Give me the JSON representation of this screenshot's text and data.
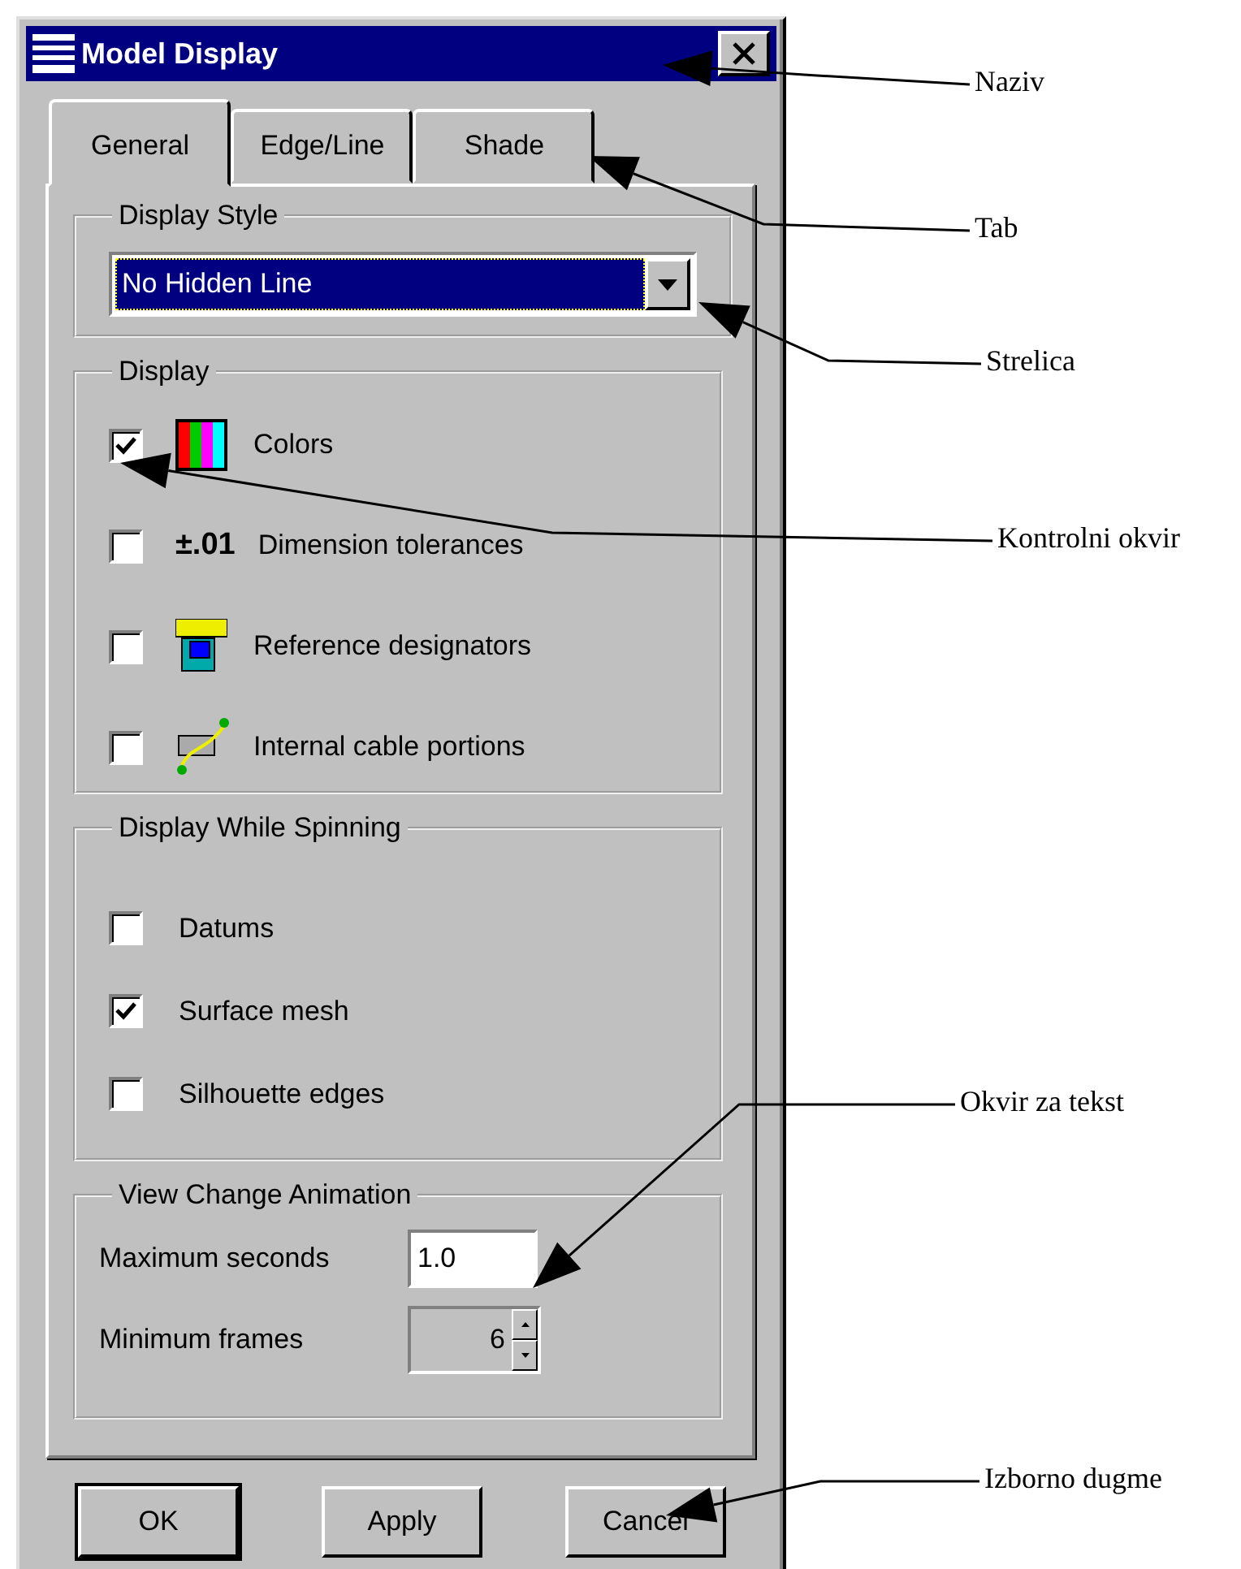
{
  "window": {
    "title": "Model Display"
  },
  "tabs": [
    {
      "label": "General",
      "selected": true
    },
    {
      "label": "Edge/Line",
      "selected": false
    },
    {
      "label": "Shade",
      "selected": false
    }
  ],
  "display_style": {
    "legend": "Display Style",
    "value": "No Hidden Line"
  },
  "display": {
    "legend": "Display",
    "items": [
      {
        "kind": "colors",
        "label": "Colors",
        "checked": true
      },
      {
        "kind": "symbol",
        "symbol": "±.01",
        "label": "Dimension tolerances",
        "checked": false
      },
      {
        "kind": "designator",
        "label": "Reference designators",
        "checked": false
      },
      {
        "kind": "cable",
        "label": "Internal cable portions",
        "checked": false
      }
    ]
  },
  "spinning": {
    "legend": "Display While Spinning",
    "items": [
      {
        "label": "Datums",
        "checked": false
      },
      {
        "label": "Surface mesh",
        "checked": true
      },
      {
        "label": "Silhouette edges",
        "checked": false
      }
    ]
  },
  "animation": {
    "legend": "View Change Animation",
    "fields": [
      {
        "kind": "text",
        "label": "Maximum seconds",
        "value": "1.0",
        "disabled": false
      },
      {
        "kind": "spin",
        "label": "Minimum frames",
        "value": "6",
        "disabled": true
      }
    ]
  },
  "buttons": [
    {
      "label": "OK",
      "default": true
    },
    {
      "label": "Apply",
      "default": false
    },
    {
      "label": "Cancel",
      "default": false
    }
  ],
  "callouts": [
    {
      "label": "Naziv"
    },
    {
      "label": "Tab"
    },
    {
      "label": "Strelica"
    },
    {
      "label": "Kontrolni okvir"
    },
    {
      "label": "Okvir za tekst"
    },
    {
      "label": "Izborno dugme"
    }
  ]
}
